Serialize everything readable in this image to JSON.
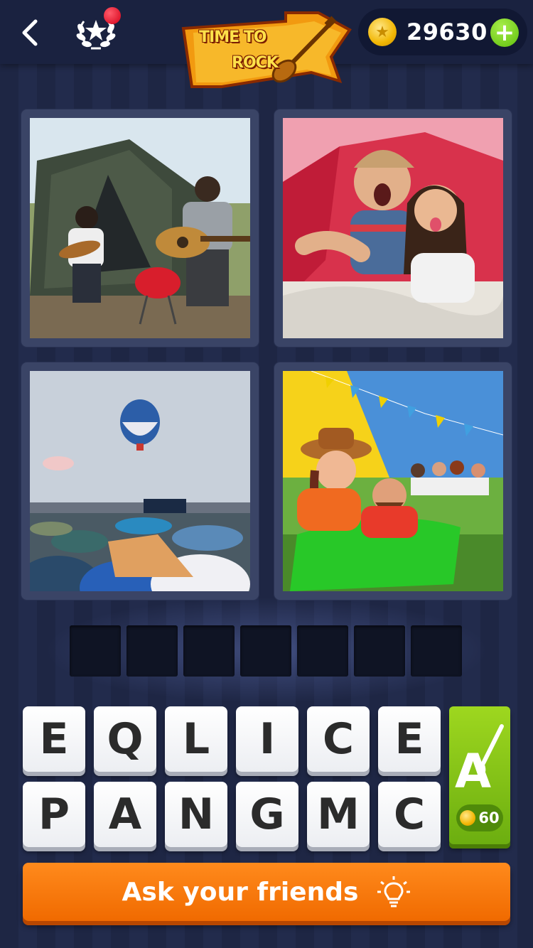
{
  "header": {
    "back_icon": "chevron-left-icon",
    "achievements_icon": "laurel-star-icon",
    "banner": {
      "line1": "TIME TO",
      "line2": "ROCK"
    },
    "coins": {
      "amount": "29630",
      "add_label": "+"
    }
  },
  "puzzle": {
    "photos": [
      {
        "subject": "camping-guitar"
      },
      {
        "subject": "tent-selfie"
      },
      {
        "subject": "festival-balloon"
      },
      {
        "subject": "festival-picnic"
      }
    ],
    "answer_length": 7,
    "answer_slots": [
      "",
      "",
      "",
      "",
      "",
      "",
      ""
    ],
    "letters": [
      "E",
      "Q",
      "L",
      "I",
      "C",
      "E",
      "P",
      "A",
      "N",
      "G",
      "M",
      "C"
    ]
  },
  "hint": {
    "icon": "paintbrush-letter-icon",
    "letter": "A",
    "cost": "60"
  },
  "ask_friends": {
    "label": "Ask your friends",
    "icon": "lightbulb-icon"
  },
  "colors": {
    "background": "#1f2746",
    "accent_orange": "#f27a0c",
    "hint_green": "#7fbf14",
    "coin_gold": "#f2b705"
  }
}
